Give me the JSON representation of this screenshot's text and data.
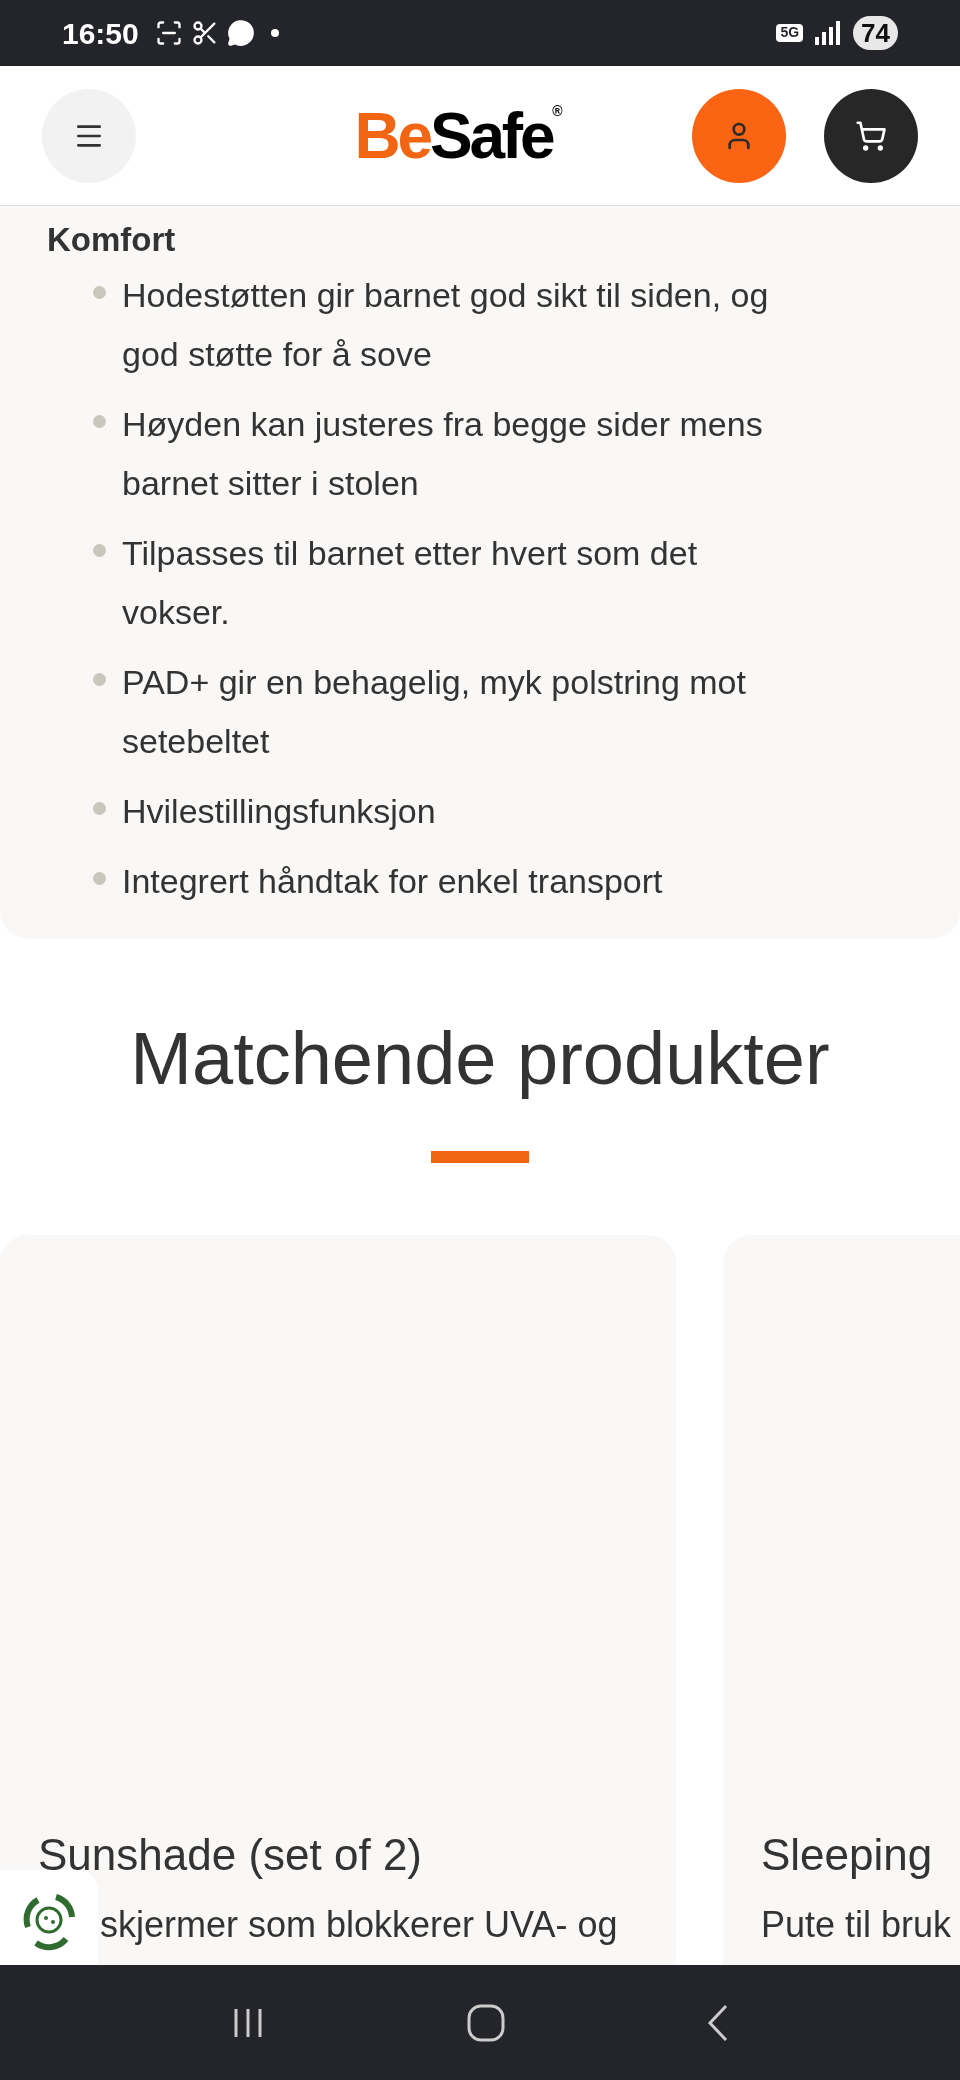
{
  "status_bar": {
    "time": "16:50",
    "network": "5G",
    "battery": "74"
  },
  "header": {
    "logo": {
      "first": "Be",
      "second": "Safe",
      "mark": "®"
    }
  },
  "feature_section": {
    "title": "Komfort",
    "items": [
      "Hodestøtten gir barnet god sikt til siden, og god støtte for å sove",
      "Høyden kan justeres fra begge sider mens barnet sitter i stolen",
      "Tilpasses til barnet etter hvert som det vokser.",
      "PAD+ gir en behagelig, myk polstring mot setebeltet",
      "Hvilestillingsfunksjon",
      "Integrert håndtak for enkel transport"
    ]
  },
  "matching": {
    "title": "Matchende produkter",
    "products": [
      {
        "name": "Sunshade (set of 2)",
        "description": "skjermer som blokkerer UVA- og"
      },
      {
        "name": "Sleeping",
        "description": "Pute til bruk"
      }
    ]
  }
}
